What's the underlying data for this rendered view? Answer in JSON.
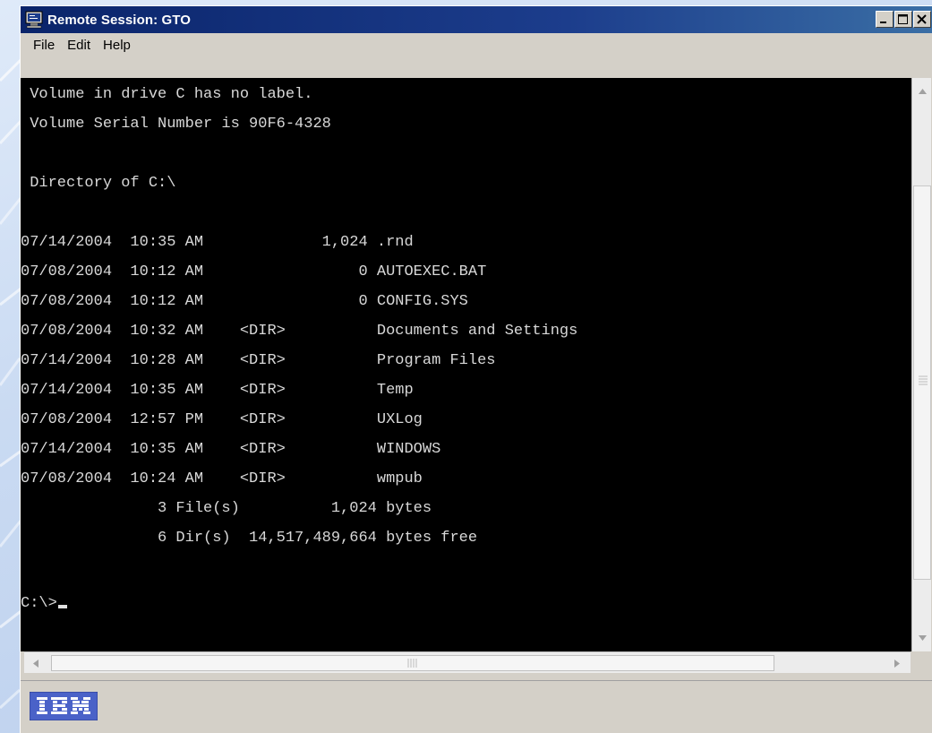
{
  "window": {
    "title": "Remote Session: GTO",
    "controls": [
      "minimize-icon",
      "maximize-icon",
      "close-icon"
    ]
  },
  "menu": {
    "items": [
      {
        "label": "File"
      },
      {
        "label": "Edit"
      },
      {
        "label": "Help"
      }
    ]
  },
  "console": {
    "lines": [
      " Volume in drive C has no label.",
      " Volume Serial Number is 90F6-4328",
      "",
      " Directory of C:\\",
      "",
      "07/14/2004  10:35 AM             1,024 .rnd",
      "07/08/2004  10:12 AM                 0 AUTOEXEC.BAT",
      "07/08/2004  10:12 AM                 0 CONFIG.SYS",
      "07/08/2004  10:32 AM    <DIR>          Documents and Settings",
      "07/14/2004  10:28 AM    <DIR>          Program Files",
      "07/14/2004  10:35 AM    <DIR>          Temp",
      "07/08/2004  12:57 PM    <DIR>          UXLog",
      "07/14/2004  10:35 AM    <DIR>          WINDOWS",
      "07/08/2004  10:24 AM    <DIR>          wmpub",
      "               3 File(s)          1,024 bytes",
      "               6 Dir(s)  14,517,489,664 bytes free",
      "",
      "C:\\>"
    ]
  },
  "statusbar": {
    "logo_text": "IBM"
  },
  "colors": {
    "titlebar": "#0a246a",
    "console_bg": "#000000",
    "console_fg": "#d8d8d8",
    "chrome": "#d4d0c8"
  }
}
